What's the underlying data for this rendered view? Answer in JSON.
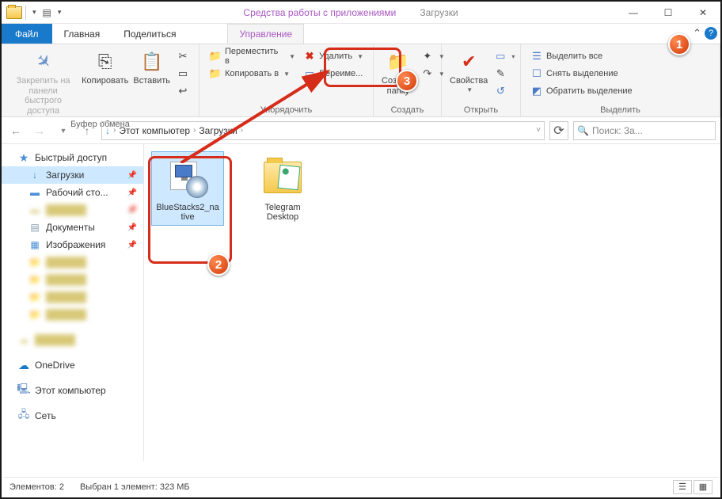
{
  "window": {
    "contextual_tab_title": "Средства работы с приложениями",
    "title": "Загрузки"
  },
  "tabs": {
    "file": "Файл",
    "home": "Главная",
    "share": "Поделиться",
    "manage": "Управление"
  },
  "ribbon": {
    "clipboard": {
      "pin": "Закрепить на панели быстрого доступа",
      "copy": "Копировать",
      "paste": "Вставить",
      "title": "Буфер обмена"
    },
    "organize": {
      "move_to": "Переместить в",
      "copy_to": "Копировать в",
      "delete": "Удалить",
      "rename": "Переиме...",
      "title": "Упорядочить"
    },
    "new": {
      "new_folder": "Создать папку",
      "title": "Создать"
    },
    "open": {
      "properties": "Свойства",
      "title": "Открыть"
    },
    "select": {
      "select_all": "Выделить все",
      "select_none": "Снять выделение",
      "invert": "Обратить выделение",
      "title": "Выделить"
    }
  },
  "address": {
    "root": "Этот компьютер",
    "current": "Загрузки"
  },
  "search": {
    "placeholder": "Поиск: За..."
  },
  "sidebar": {
    "quick_access": "Быстрый доступ",
    "downloads": "Загрузки",
    "desktop": "Рабочий сто...",
    "documents": "Документы",
    "pictures": "Изображения",
    "onedrive": "OneDrive",
    "this_pc": "Этот компьютер",
    "network": "Сеть"
  },
  "files": [
    {
      "name": "BlueStacks2_native"
    },
    {
      "name": "Telegram Desktop"
    }
  ],
  "status": {
    "items": "Элементов: 2",
    "selected": "Выбран 1 элемент: 323 МБ"
  },
  "annotations": {
    "b1": "1",
    "b2": "2",
    "b3": "3"
  }
}
